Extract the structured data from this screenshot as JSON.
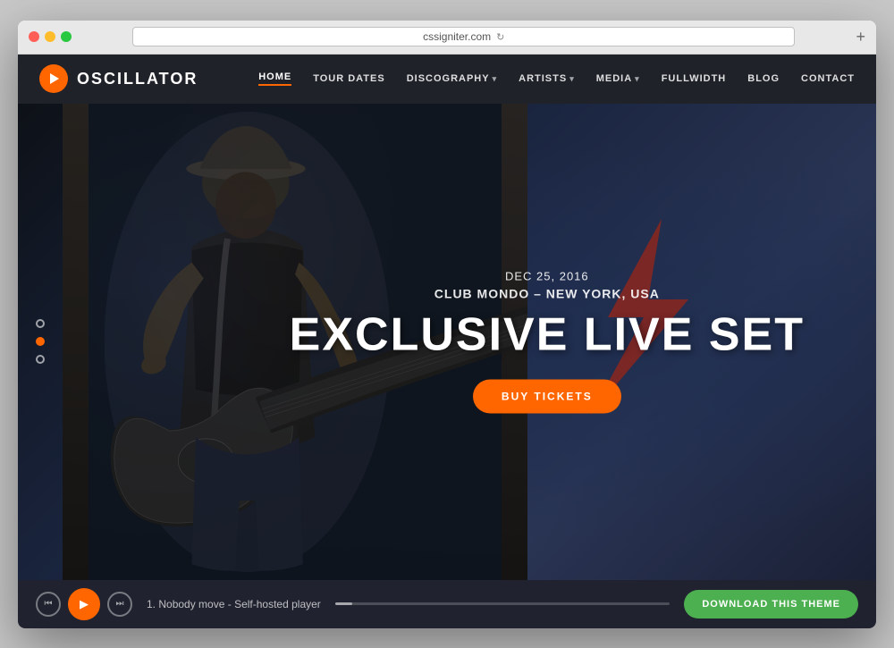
{
  "browser": {
    "url": "cssigniter.com",
    "new_tab_label": "+"
  },
  "navbar": {
    "logo_text": "OSCILLATOR",
    "nav_items": [
      {
        "label": "HOME",
        "active": true,
        "has_dropdown": false
      },
      {
        "label": "TOUR DATES",
        "active": false,
        "has_dropdown": false
      },
      {
        "label": "DISCOGRAPHY",
        "active": false,
        "has_dropdown": true
      },
      {
        "label": "ARTISTS",
        "active": false,
        "has_dropdown": true
      },
      {
        "label": "MEDIA",
        "active": false,
        "has_dropdown": true
      },
      {
        "label": "FULLWIDTH",
        "active": false,
        "has_dropdown": false
      },
      {
        "label": "BLOG",
        "active": false,
        "has_dropdown": false
      },
      {
        "label": "CONTACT",
        "active": false,
        "has_dropdown": false
      }
    ]
  },
  "hero": {
    "date": "DEC 25, 2016",
    "venue": "CLUB MONDO – NEW YORK, USA",
    "title": "EXCLUSIVE LIVE SET",
    "cta_label": "BUY TICKETS"
  },
  "slide_dots": [
    {
      "active": false
    },
    {
      "active": true
    },
    {
      "active": false
    }
  ],
  "player": {
    "track_number": "1.",
    "track_name": "Nobody move - Self-hosted player",
    "download_label": "DOWNLOAD THIS THEME"
  }
}
